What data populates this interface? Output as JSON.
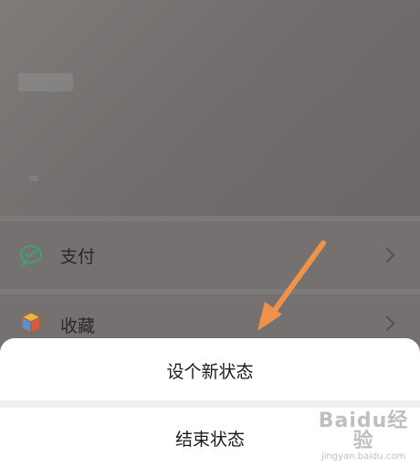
{
  "menu": {
    "items": [
      {
        "label": "支付",
        "icon": "wechat-pay-icon"
      },
      {
        "label": "收藏",
        "icon": "favorites-cube-icon"
      }
    ]
  },
  "action_sheet": {
    "options": [
      {
        "label": "设个新状态"
      },
      {
        "label": "结束状态"
      }
    ]
  },
  "watermark": {
    "logo": "Baidu经验",
    "url": "jingyan.baidu.com"
  },
  "colors": {
    "arrow": "#f0924a",
    "pay_icon": "#3fa36b",
    "overlay": "#7a7776"
  }
}
